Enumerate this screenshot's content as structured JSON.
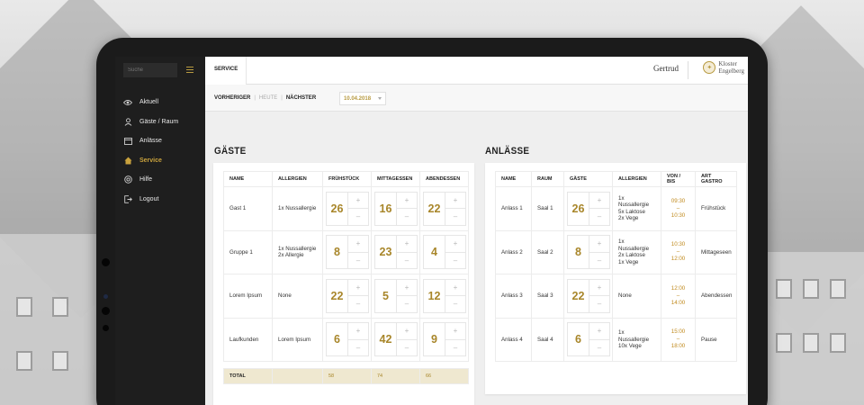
{
  "sidebar": {
    "search_placeholder": "Suche",
    "items": [
      {
        "label": "Aktuell",
        "icon": "eye-icon",
        "active": false
      },
      {
        "label": "Gäste / Raum",
        "icon": "user-icon",
        "active": false
      },
      {
        "label": "Anlässe",
        "icon": "calendar-icon",
        "active": false
      },
      {
        "label": "Service",
        "icon": "home-icon",
        "active": true
      },
      {
        "label": "Hilfe",
        "icon": "lifebuoy-icon",
        "active": false
      },
      {
        "label": "Logout",
        "icon": "logout-icon",
        "active": false
      }
    ]
  },
  "header": {
    "tab": "SERVICE",
    "user": "Gertrud",
    "logo_line1": "Kloster",
    "logo_line2": "Engelberg"
  },
  "datebar": {
    "prev": "VORHERIGER",
    "today": "HEUTE",
    "next": "NÄCHSTER",
    "date": "10.04.2018"
  },
  "colors": {
    "accent": "#a8862a",
    "sidebar_bg": "#1e1e1e",
    "total_bg": "#efe8d0"
  },
  "gaeste": {
    "title": "GÄSTE",
    "headers": [
      "NAME",
      "ALLERGIEN",
      "FRÜHSTÜCK",
      "MITTAGESSEN",
      "ABENDESSEN"
    ],
    "rows": [
      {
        "name": "Gast 1",
        "allergies": [
          "1x Nussallergie"
        ],
        "fruehstueck": "26",
        "mittagessen": "16",
        "abendessen": "22"
      },
      {
        "name": "Gruppe 1",
        "allergies": [
          "1x Nussallergie",
          "2x Allergie"
        ],
        "fruehstueck": "8",
        "mittagessen": "23",
        "abendessen": "4"
      },
      {
        "name": "Lorem Ipsum",
        "allergies": [
          "None"
        ],
        "fruehstueck": "22",
        "mittagessen": "5",
        "abendessen": "12"
      },
      {
        "name": "Laufkunden",
        "allergies": [
          "Lorem Ipsum"
        ],
        "fruehstueck": "6",
        "mittagessen": "42",
        "abendessen": "9"
      }
    ],
    "total_label": "TOTAL",
    "totals": [
      "58",
      "74",
      "66"
    ]
  },
  "anlaesse": {
    "title": "ANLÄSSE",
    "headers": [
      "NAME",
      "RAUM",
      "GÄSTE",
      "ALLERGIEN",
      "VON / BIS",
      "ART GASTRO"
    ],
    "rows": [
      {
        "name": "Anlass 1",
        "raum": "Saal 1",
        "gaeste": "26",
        "allergies": [
          "1x Nussallergie",
          "5x Laktose",
          "2x Vege"
        ],
        "von": "09:30",
        "bis": "10:30",
        "art": "Frühstück"
      },
      {
        "name": "Anlass 2",
        "raum": "Saal 2",
        "gaeste": "8",
        "allergies": [
          "1x Nussallergie",
          "2x Laktose",
          "1x Vege"
        ],
        "von": "10:30",
        "bis": "12:00",
        "art": "Mittageseen"
      },
      {
        "name": "Anlass 3",
        "raum": "Saal 3",
        "gaeste": "22",
        "allergies": [
          "None"
        ],
        "von": "12:00",
        "bis": "14:00",
        "art": "Abendessen"
      },
      {
        "name": "Anlass 4",
        "raum": "Saal 4",
        "gaeste": "6",
        "allergies": [
          "1x Nussallergie",
          "10x Vege"
        ],
        "von": "15:00",
        "bis": "18:00",
        "art": "Pause"
      }
    ],
    "dash": "–",
    "plus": "+",
    "minus": "–"
  }
}
